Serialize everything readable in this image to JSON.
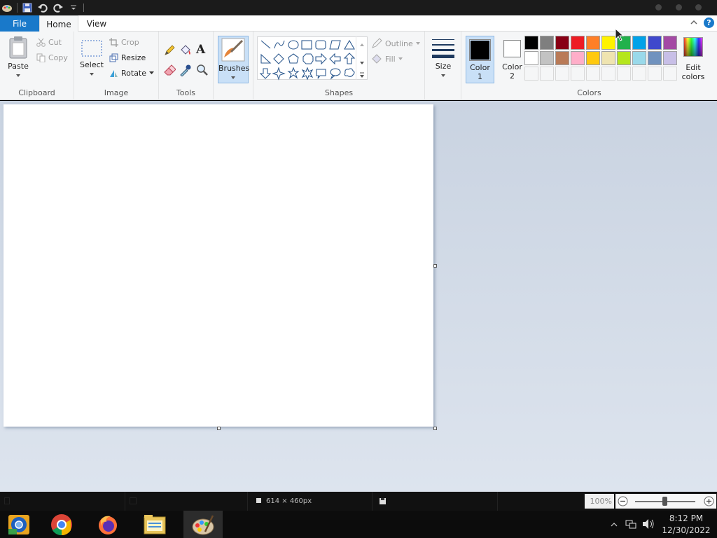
{
  "titlebar": {
    "quick_access": [
      "paint-app-icon",
      "save-icon",
      "undo-icon",
      "redo-icon",
      "customize-quick-access-icon"
    ]
  },
  "tabs": {
    "file": "File",
    "home": "Home",
    "view": "View"
  },
  "ribbon": {
    "clipboard": {
      "label": "Clipboard",
      "paste": "Paste",
      "cut": "Cut",
      "copy": "Copy"
    },
    "image": {
      "label": "Image",
      "select": "Select",
      "crop": "Crop",
      "resize": "Resize",
      "rotate": "Rotate"
    },
    "tools": {
      "label": "Tools"
    },
    "brushes": {
      "label": "Brushes"
    },
    "shapes": {
      "label": "Shapes",
      "outline": "Outline",
      "fill": "Fill"
    },
    "size": {
      "label": "Size"
    },
    "colors": {
      "label": "Colors",
      "color1_line1": "Color",
      "color1_line2": "1",
      "color2_line1": "Color",
      "color2_line2": "2",
      "edit_line1": "Edit",
      "edit_line2": "colors",
      "color1_value": "#000000",
      "color2_value": "#ffffff",
      "palette_row1": [
        "#000000",
        "#7f7f7f",
        "#880015",
        "#ed1c24",
        "#ff7f27",
        "#fff200",
        "#22b14c",
        "#00a2e8",
        "#3f48cc",
        "#a349a4"
      ],
      "palette_row2": [
        "#ffffff",
        "#c3c3c3",
        "#b97a57",
        "#ffaec9",
        "#ffc90e",
        "#efe4b0",
        "#b5e61d",
        "#99d9ea",
        "#7092be",
        "#c8bfe7"
      ]
    }
  },
  "status": {
    "canvas_size": "614 × 460px",
    "zoom": "100%",
    "zoom_level": 1.0
  },
  "taskbar": {
    "apps": [
      "chromium-icon",
      "chrome-icon",
      "firefox-icon",
      "file-manager-icon",
      "paint-taskbar-icon"
    ],
    "time": "8:12 PM",
    "date": "12/30/2022"
  },
  "colors": {
    "accent": "#1979ca",
    "canvas_bg": "#c9d3e1",
    "ribbon_bg": "#f5f6f7"
  }
}
